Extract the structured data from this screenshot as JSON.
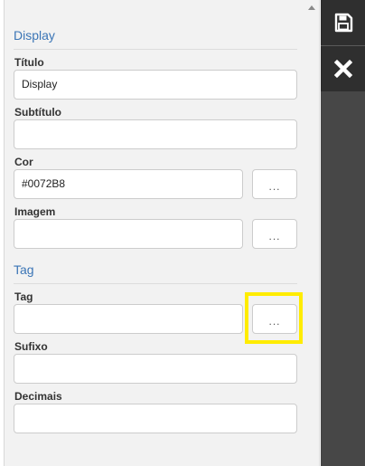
{
  "sections": {
    "display": "Display",
    "tag": "Tag"
  },
  "fields": {
    "titulo": {
      "label": "Título",
      "value": "Display"
    },
    "subtitulo": {
      "label": "Subtítulo",
      "value": ""
    },
    "cor": {
      "label": "Cor",
      "value": "#0072B8",
      "button": "..."
    },
    "imagem": {
      "label": "Imagem",
      "value": "",
      "button": "..."
    },
    "tag": {
      "label": "Tag",
      "value": "",
      "button": "..."
    },
    "sufixo": {
      "label": "Sufixo",
      "value": ""
    },
    "decimais": {
      "label": "Decimais",
      "value": ""
    }
  },
  "toolbar": {
    "save_icon": "floppy-disk",
    "close_icon": "close-x"
  },
  "colors": {
    "section_title": "#3b75b6",
    "highlight": "#ffec00",
    "toolbar": "#474747"
  }
}
